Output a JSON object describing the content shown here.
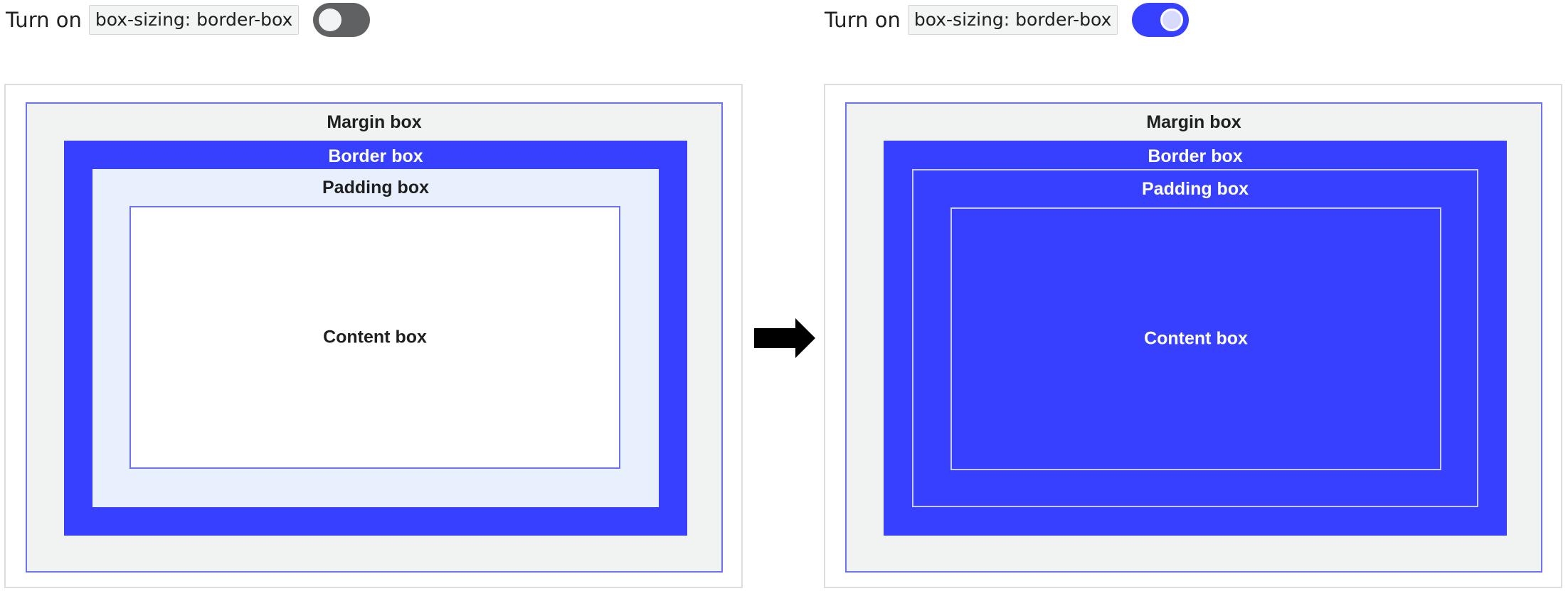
{
  "toggles": [
    {
      "label": "Turn on",
      "code": "box-sizing: border-box",
      "state": "off"
    },
    {
      "label": "Turn on",
      "code": "box-sizing: border-box",
      "state": "on"
    }
  ],
  "diagrams": [
    {
      "margin_label": "Margin box",
      "border_label": "Border box",
      "padding_label": "Padding box",
      "content_label": "Content box"
    },
    {
      "margin_label": "Margin box",
      "border_label": "Border box",
      "padding_label": "Padding box",
      "content_label": "Content box"
    }
  ],
  "colors": {
    "accent": "#3740ff",
    "margin_fill": "#f1f3f3",
    "padding_fill_default": "#e8f0fe",
    "toggle_off": "#5f6163"
  },
  "icons": {
    "arrow": "arrow-right-icon"
  }
}
